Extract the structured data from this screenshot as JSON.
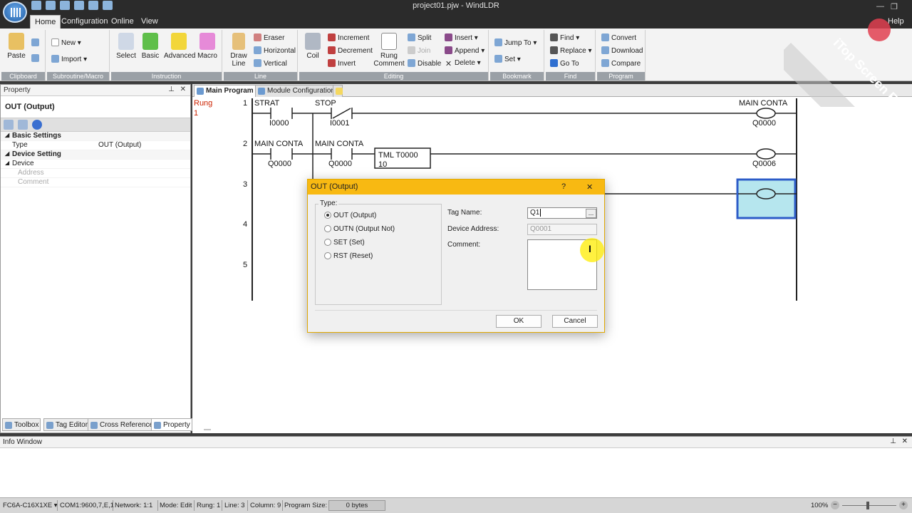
{
  "window": {
    "title": "project01.pjw - WindLDR",
    "help": "Help"
  },
  "ribbon_tabs": [
    "Home",
    "Configuration",
    "Online",
    "View"
  ],
  "ribbon": {
    "clipboard": {
      "label": "Clipboard",
      "paste": "Paste"
    },
    "subroutine": {
      "label": "Subroutine/Macro",
      "new": "New",
      "import": "Import"
    },
    "instruction": {
      "label": "Instruction",
      "select": "Select",
      "basic": "Basic",
      "advanced": "Advanced",
      "macro": "Macro"
    },
    "line": {
      "label": "Line",
      "draw": "Draw Line",
      "eraser": "Eraser",
      "horizontal": "Horizontal",
      "vertical": "Vertical"
    },
    "editing": {
      "label": "Editing",
      "coil": "Coil",
      "increment": "Increment",
      "decrement": "Decrement",
      "invert": "Invert",
      "rung_comment": "Rung Comment",
      "split": "Split",
      "join": "Join",
      "disable": "Disable",
      "insert": "Insert",
      "append": "Append",
      "delete": "Delete"
    },
    "bookmark": {
      "label": "Bookmark",
      "jump_to": "Jump To",
      "set": "Set"
    },
    "find": {
      "label": "Find",
      "find": "Find",
      "replace": "Replace",
      "goto": "Go To"
    },
    "program": {
      "label": "Program",
      "convert": "Convert",
      "download": "Download",
      "compare": "Compare"
    }
  },
  "property_panel": {
    "header": "Property",
    "object_title": "OUT (Output)",
    "basic_settings": "Basic Settings",
    "type_key": "Type",
    "type_value": "OUT (Output)",
    "device_setting": "Device Setting",
    "device": "Device",
    "address": "Address",
    "comment": "Comment",
    "bottom_tabs": [
      "Toolbox",
      "Tag Editor",
      "Cross Reference",
      "Property"
    ]
  },
  "doc_tabs": [
    "Main Program",
    "Module Configuration"
  ],
  "ladder": {
    "rung_label": "Rung",
    "rung_num": "1",
    "rung_numbers": [
      "1",
      "2",
      "3",
      "4",
      "5"
    ],
    "r1": {
      "c1_name": "STRAT",
      "c1_addr": "I0000",
      "c2_name": "STOP",
      "c2_addr": "I0001",
      "coil_name": "MAIN CONTA",
      "coil_addr": "Q0000"
    },
    "r2": {
      "c1_name": "MAIN CONTA",
      "c1_addr": "Q0000",
      "c2_name": "MAIN CONTA",
      "c2_addr": "Q0000",
      "tml": "TML T0000",
      "tml_val": "10",
      "coil_addr": "Q0006"
    }
  },
  "info_window": {
    "header": "Info Window"
  },
  "status_bar": {
    "plc": "FC6A-C16X1XE",
    "com": "COM1:9600,7,E,1",
    "network": "Network: 1:1",
    "mode": "Mode: Edit",
    "rung": "Rung: 1",
    "line": "Line: 3",
    "column": "Column: 9",
    "program_size": "Program Size:",
    "bytes": "0 bytes",
    "zoom": "100%"
  },
  "dialog": {
    "title": "OUT (Output)",
    "help": "?",
    "close": "✕",
    "type_legend": "Type:",
    "options": [
      "OUT (Output)",
      "OUTN (Output Not)",
      "SET (Set)",
      "RST (Reset)"
    ],
    "selected": 0,
    "tag_name_label": "Tag Name:",
    "tag_name_value": "Q1",
    "browse": "...",
    "device_address_label": "Device Address:",
    "device_address_value": "Q0001",
    "comment_label": "Comment:",
    "ok": "OK",
    "cancel": "Cancel"
  },
  "watermark": "iTop Screen Recorder",
  "colors": {
    "dialog_title": "#f8b912",
    "selected_cell": "#b6e6ee",
    "selected_border": "#2d5cc8",
    "rung_label": "#cc2200"
  }
}
